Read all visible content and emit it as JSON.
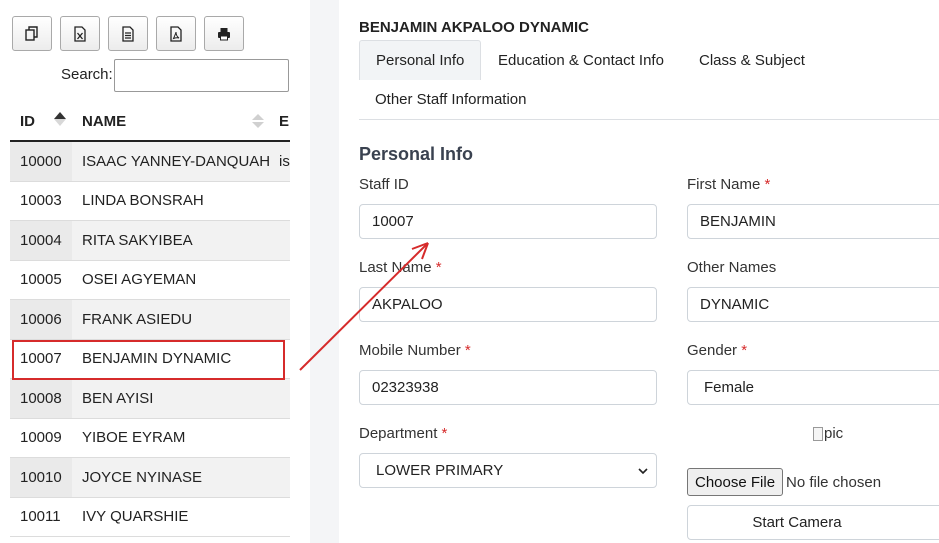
{
  "toolbar": {
    "buttons": [
      {
        "icon": "copy-icon"
      },
      {
        "icon": "excel-icon"
      },
      {
        "icon": "csv-icon"
      },
      {
        "icon": "pdf-icon"
      },
      {
        "icon": "print-icon"
      }
    ]
  },
  "search": {
    "label": "Search:",
    "value": ""
  },
  "table": {
    "headers": {
      "id": "ID",
      "name": "NAME",
      "extra": "E"
    },
    "rows": [
      {
        "id": "10000",
        "name": "ISAAC YANNEY-DANQUAH",
        "extra": "is"
      },
      {
        "id": "10003",
        "name": "LINDA BONSRAH",
        "extra": ""
      },
      {
        "id": "10004",
        "name": "RITA SAKYIBEA",
        "extra": ""
      },
      {
        "id": "10005",
        "name": "OSEI AGYEMAN",
        "extra": ""
      },
      {
        "id": "10006",
        "name": "FRANK ASIEDU",
        "extra": ""
      },
      {
        "id": "10007",
        "name": "BENJAMIN DYNAMIC",
        "extra": ""
      },
      {
        "id": "10008",
        "name": "BEN AYISI",
        "extra": ""
      },
      {
        "id": "10009",
        "name": "YIBOE EYRAM",
        "extra": ""
      },
      {
        "id": "10010",
        "name": "JOYCE NYINASE",
        "extra": ""
      },
      {
        "id": "10011",
        "name": "IVY QUARSHIE",
        "extra": ""
      }
    ]
  },
  "staff": {
    "title": "BENJAMIN AKPALOO DYNAMIC",
    "tabs": [
      "Personal Info",
      "Education & Contact Info",
      "Class & Subject",
      "Other Staff Information"
    ],
    "section_title": "Personal Info",
    "fields": {
      "staff_id": {
        "label": "Staff ID",
        "value": "10007"
      },
      "first_name": {
        "label": "First Name",
        "value": "BENJAMIN"
      },
      "last_name": {
        "label": "Last Name",
        "value": "AKPALOO"
      },
      "other_names": {
        "label": "Other Names",
        "value": "DYNAMIC"
      },
      "mobile": {
        "label": "Mobile Number",
        "value": "02323938"
      },
      "gender": {
        "label": "Gender",
        "value": "Female"
      },
      "department": {
        "label": "Department",
        "value": "LOWER PRIMARY"
      }
    },
    "required_mark": "*",
    "pic_alt": "pic",
    "choose_file": "Choose File",
    "no_file": "No file chosen",
    "start_camera": "Start Camera"
  },
  "colors": {
    "highlight": "#d62b2b",
    "required": "#d62b2b",
    "arrow": "#d62b2b"
  }
}
